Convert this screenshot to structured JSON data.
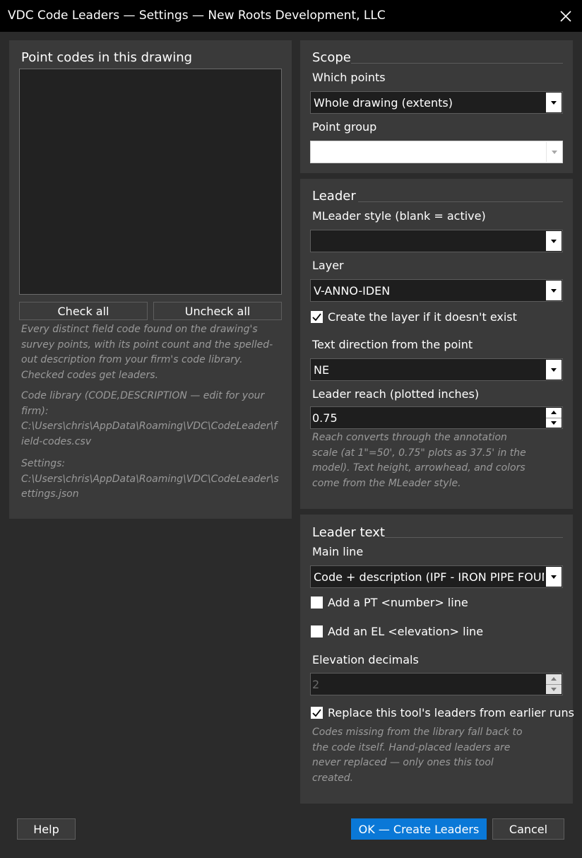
{
  "window": {
    "title": "VDC Code Leaders — Settings — New Roots Development, LLC"
  },
  "codes_panel": {
    "title": "Point codes in this drawing",
    "check_all_label": "Check all",
    "uncheck_all_label": "Uncheck all",
    "description": "Every distinct field code found on the drawing's survey points, with its point count and the spelled-out description from your firm's code library. Checked codes get leaders.",
    "library_label": "Code library (CODE,DESCRIPTION — edit for your firm):",
    "library_path": "C:\\Users\\chris\\AppData\\Roaming\\VDC\\CodeLeader\\field-codes.csv",
    "settings_label": "Settings:",
    "settings_path": "C:\\Users\\chris\\AppData\\Roaming\\VDC\\CodeLeader\\settings.json"
  },
  "scope": {
    "title": "Scope",
    "which_points_label": "Which points",
    "which_points_value": "Whole drawing (extents)",
    "point_group_label": "Point group",
    "point_group_value": ""
  },
  "leader": {
    "title": "Leader",
    "mleader_style_label": "MLeader style (blank = active)",
    "mleader_style_value": "",
    "layer_label": "Layer",
    "layer_value": "V-ANNO-IDEN",
    "create_layer_label": "Create the layer if it doesn't exist",
    "create_layer_checked": true,
    "direction_label": "Text direction from the point",
    "direction_value": "NE",
    "reach_label": "Leader reach (plotted inches)",
    "reach_value": "0.75",
    "note": "Reach converts through the annotation scale (at 1\"=50', 0.75\" plots as 37.5' in the model). Text height, arrowhead, and colors come from the MLeader style."
  },
  "leader_text": {
    "title": "Leader text",
    "main_line_label": "Main line",
    "main_line_value": "Code + description (IPF - IRON PIPE FOUND)",
    "add_pt_label": "Add a PT <number> line",
    "add_pt_checked": false,
    "add_el_label": "Add an EL <elevation> line",
    "add_el_checked": false,
    "decimals_label": "Elevation decimals",
    "decimals_value": "2",
    "replace_label": "Replace this tool's leaders from earlier runs",
    "replace_checked": true,
    "note": "Codes missing from the library fall back to the code itself. Hand-placed leaders are never replaced — only ones this tool created."
  },
  "footer": {
    "help_label": "Help",
    "ok_label": "OK — Create Leaders",
    "cancel_label": "Cancel"
  },
  "colors": {
    "background": "#2b2b2b",
    "panel": "#3a3a3a",
    "accent": "#0a78d7",
    "titlebar": "#000000"
  }
}
